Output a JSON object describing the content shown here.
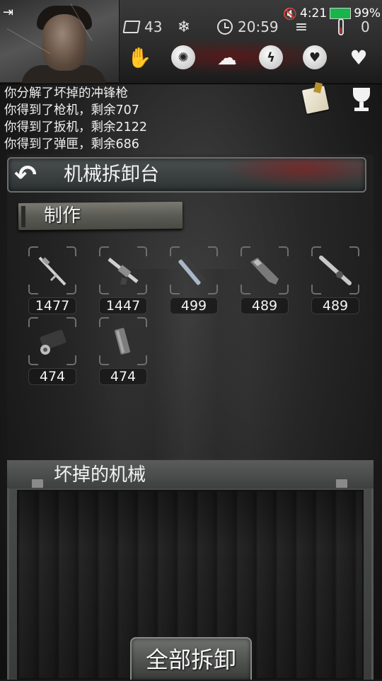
{
  "status_bar": {
    "time": "4:21",
    "battery": "99%"
  },
  "stats": {
    "days": "43",
    "clock": "20:59",
    "temperature": "0"
  },
  "log": [
    "你分解了坏掉的冲锋枪",
    "你得到了枪机，剩余707",
    "你得到了扳机，剩余2122",
    "你得到了弹匣，剩余686"
  ],
  "page": {
    "title": "机械拆卸台",
    "section": "制作"
  },
  "parts": [
    {
      "name": "rifle-barrel",
      "count": "1477"
    },
    {
      "name": "rifle-receiver",
      "count": "1447"
    },
    {
      "name": "bolt",
      "count": "499"
    },
    {
      "name": "stock",
      "count": "489"
    },
    {
      "name": "scope",
      "count": "489"
    },
    {
      "name": "trigger-assembly",
      "count": "474"
    },
    {
      "name": "magazine",
      "count": "474"
    }
  ],
  "broken": {
    "title": "坏掉的机械",
    "button": "全部拆卸"
  },
  "icons": {
    "back": "back-arrow-icon",
    "calendar": "calendar-icon",
    "snowflake": "snowflake-icon",
    "clock": "clock-icon",
    "menu": "menu-icon",
    "thermometer": "thermometer-icon",
    "status": [
      "hand-icon",
      "brain-icon",
      "stomach-icon",
      "energy-icon",
      "heart-mood-icon",
      "health-heart-icon"
    ]
  },
  "colors": {
    "battery": "#18b64a",
    "blood": "#8c0a0a"
  }
}
